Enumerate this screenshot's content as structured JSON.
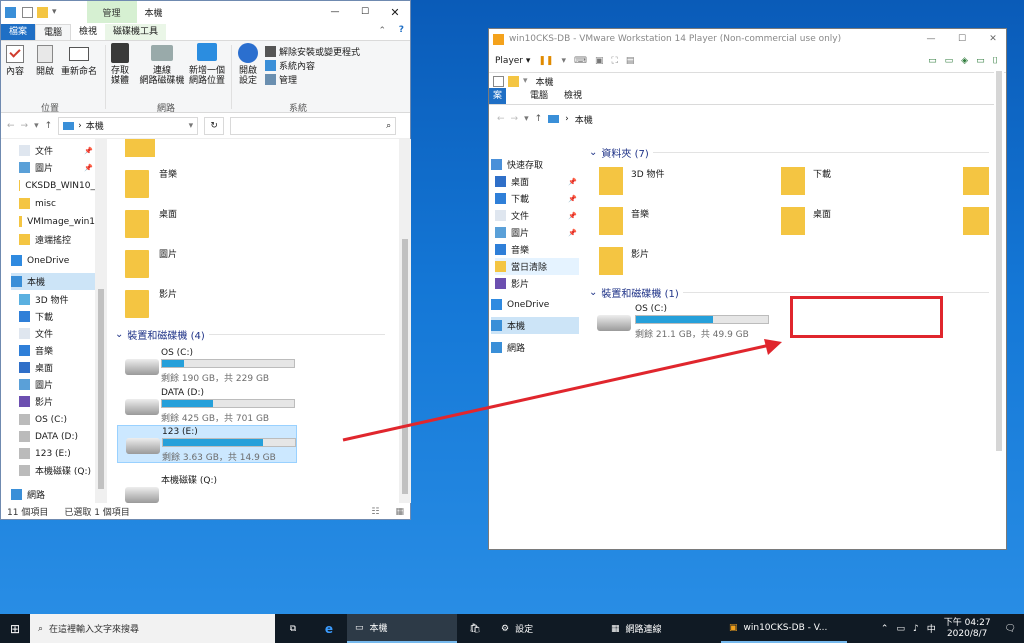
{
  "left_explorer": {
    "quick_toolbar_icon": "properties-icon",
    "title": "本機",
    "tab_manage_top": "管理",
    "tabs": [
      "檔案",
      "電腦",
      "檢視",
      "磁碟機工具"
    ],
    "ribbon": {
      "buttons": [
        "內容",
        "開啟",
        "重新命名",
        "存取\n媒體",
        "連線\n網路磁碟機",
        "新增一個\n網路位置",
        "開啟\n設定"
      ],
      "system_items": [
        "解除安裝或變更程式",
        "系統內容",
        "管理"
      ],
      "groups": [
        "位置",
        "網路",
        "系統"
      ]
    },
    "address": "本機",
    "nav": [
      "文件",
      "圖片",
      "CKSDB_WIN10_",
      "misc",
      "VMImage_win1",
      "遠端搖控",
      "OneDrive",
      "本機",
      "3D 物件",
      "下載",
      "文件",
      "音樂",
      "桌面",
      "圖片",
      "影片",
      "OS (C:)",
      "DATA (D:)",
      "123 (E:)",
      "本機磁碟 (Q:)",
      "網路"
    ],
    "folders": [
      "音樂",
      "桌面",
      "圖片",
      "影片"
    ],
    "section": "裝置和磁碟機 (4)",
    "drives": [
      {
        "name": "OS (C:)",
        "free": "剩餘 190 GB，共 229 GB",
        "pct": 0.17
      },
      {
        "name": "DATA (D:)",
        "free": "剩餘 425 GB，共 701 GB",
        "pct": 0.39
      },
      {
        "name": "123 (E:)",
        "free": "剩餘 3.63 GB，共 14.9 GB",
        "pct": 0.76
      },
      {
        "name": "本機磁碟 (Q:)",
        "free": "",
        "pct": 0
      }
    ],
    "status_items": "11 個項目",
    "status_selected": "已選取 1 個項目"
  },
  "vm": {
    "title": "win10CKS-DB - VMware Workstation 14 Player (Non-commercial use only)",
    "player_label": "Player ▾",
    "inner_title": "本機",
    "inner_tabs": [
      "案",
      "電腦",
      "檢視"
    ],
    "address": "本機",
    "nav": [
      "快速存取",
      "桌面",
      "下載",
      "文件",
      "圖片",
      "音樂",
      "當日清除",
      "影片",
      "OneDrive",
      "本機",
      "網路"
    ],
    "folders_header": "資料夾 (7)",
    "folders": [
      "3D 物件",
      "下載",
      "音樂",
      "桌面",
      "影片"
    ],
    "drives_header": "裝置和磁碟機 (1)",
    "drive": {
      "name": "OS (C:)",
      "free": "剩餘 21.1 GB，共 49.9 GB",
      "pct": 0.58
    }
  },
  "taskbar": {
    "search_placeholder": "在這裡輸入文字來搜尋",
    "apps": [
      "本機",
      "設定",
      "網路連線",
      "win10CKS-DB - V..."
    ],
    "ime": "中",
    "time": "下午 04:27",
    "date": "2020/8/7"
  },
  "colors": {
    "accent": "#1f6fc5",
    "annotation": "#e0262d",
    "progress": "#26a0da"
  }
}
